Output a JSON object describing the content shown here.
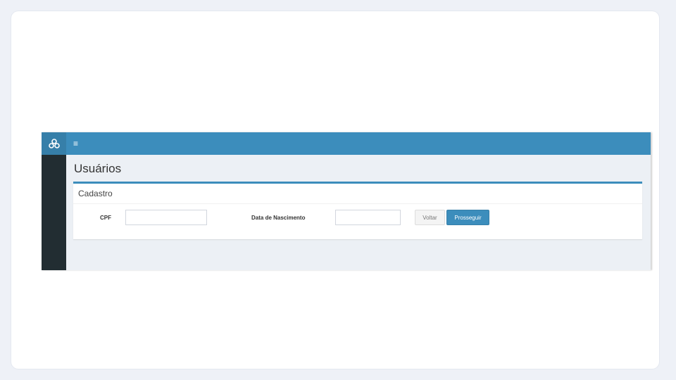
{
  "header": {
    "logo_icon": "users-cluster-icon",
    "menu_icon": "≡"
  },
  "page": {
    "title": "Usuários"
  },
  "form": {
    "box_title": "Cadastro",
    "cpf_label": "CPF",
    "cpf_value": "",
    "birth_label": "Data de Nascimento",
    "birth_value": "",
    "back_label": "Voltar",
    "next_label": "Prosseguir"
  },
  "colors": {
    "header": "#3c8dbc",
    "sidebar": "#222d32",
    "content_bg": "#ecf0f5"
  }
}
